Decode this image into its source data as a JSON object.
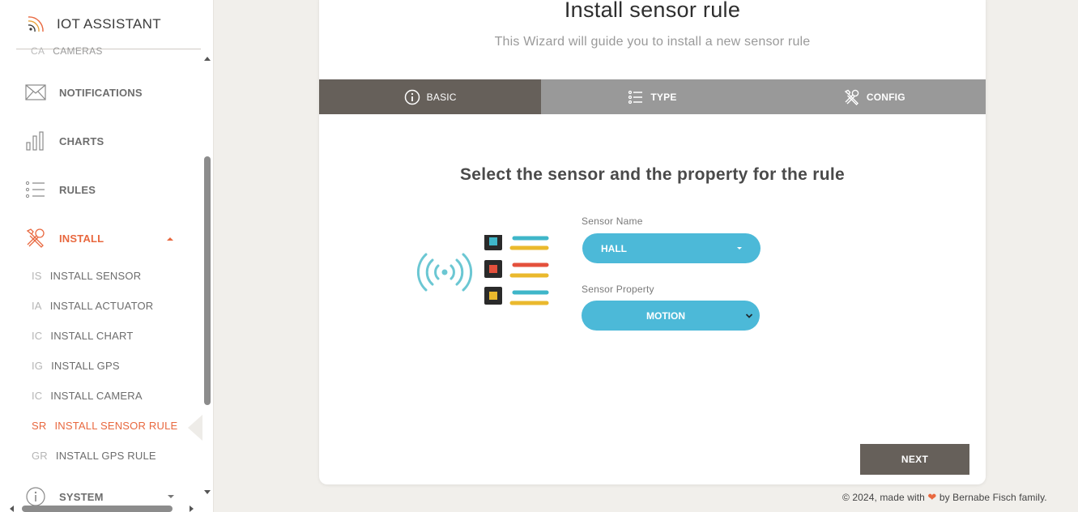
{
  "app": {
    "brand": "IOT ASSISTANT"
  },
  "sidebar": {
    "cut_item": {
      "abbr": "CA",
      "label": "CAMERAS"
    },
    "items": [
      {
        "label": "NOTIFICATIONS",
        "icon": "envelope-icon"
      },
      {
        "label": "CHARTS",
        "icon": "bar-chart-icon"
      },
      {
        "label": "RULES",
        "icon": "list-icon"
      },
      {
        "label": "INSTALL",
        "icon": "tools-icon",
        "active": true
      },
      {
        "label": "SYSTEM",
        "icon": "info-icon"
      }
    ],
    "install_submenu": [
      {
        "abbr": "IS",
        "label": "INSTALL SENSOR"
      },
      {
        "abbr": "IA",
        "label": "INSTALL ACTUATOR"
      },
      {
        "abbr": "IC",
        "label": "INSTALL CHART"
      },
      {
        "abbr": "IG",
        "label": "INSTALL GPS"
      },
      {
        "abbr": "IC",
        "label": "INSTALL CAMERA"
      },
      {
        "abbr": "SR",
        "label": "INSTALL SENSOR RULE",
        "active": true
      },
      {
        "abbr": "GR",
        "label": "INSTALL GPS RULE"
      }
    ]
  },
  "wizard": {
    "title": "Install sensor rule",
    "subtitle": "This Wizard will guide you to install a new sensor rule",
    "tabs": [
      {
        "label": "BASIC",
        "icon": "info-circle-icon",
        "active": true
      },
      {
        "label": "TYPE",
        "icon": "list-icon"
      },
      {
        "label": "CONFIG",
        "icon": "tools-icon"
      }
    ],
    "step_title": "Select the sensor and the property for the rule",
    "sensor_name_label": "Sensor Name",
    "sensor_name_value": "HALL",
    "sensor_property_label": "Sensor Property",
    "sensor_property_value": "MOTION",
    "next_label": "NEXT"
  },
  "footer": {
    "prefix": "© 2024, made with",
    "suffix": "by Bernabe Fisch family."
  },
  "colors": {
    "accent": "#e8683f",
    "select": "#4cb9d8",
    "tab_active": "#66605a",
    "tab_inactive": "#999999"
  }
}
